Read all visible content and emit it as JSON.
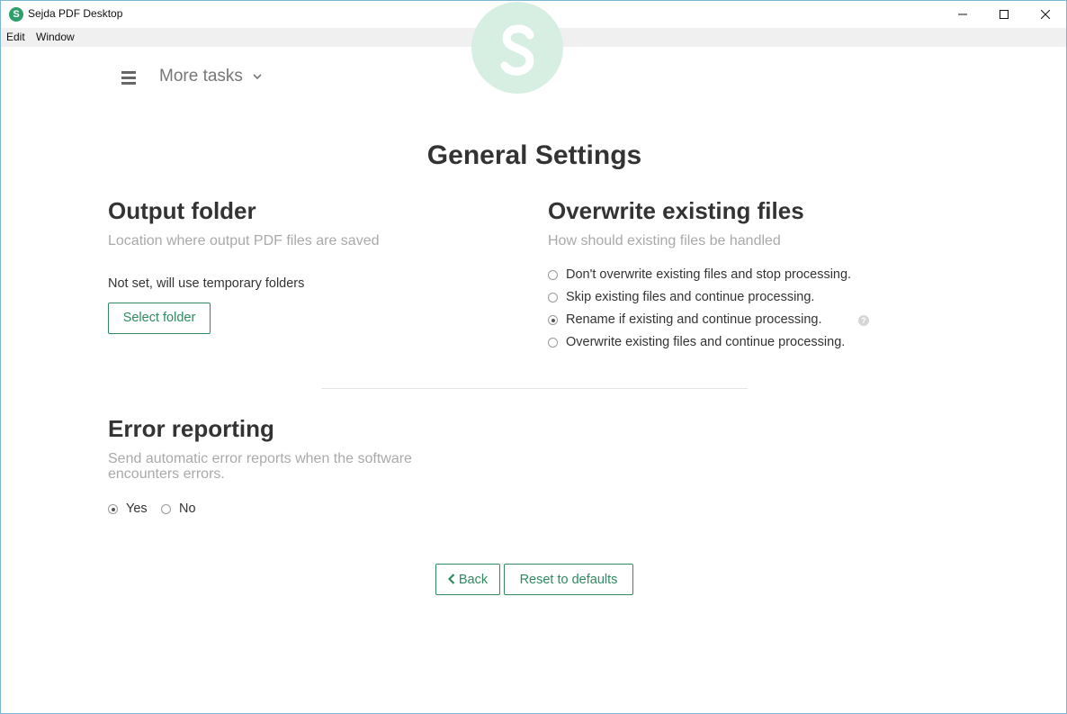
{
  "window": {
    "title": "Sejda PDF Desktop",
    "app_icon_letter": "S"
  },
  "menu": [
    "Edit",
    "Window"
  ],
  "header": {
    "more_tasks": "More tasks"
  },
  "page_title": "General Settings",
  "output_folder": {
    "title": "Output folder",
    "subtitle": "Location where output PDF files are saved",
    "status": "Not set, will use temporary folders",
    "button": "Select folder"
  },
  "overwrite": {
    "title": "Overwrite existing files",
    "subtitle": "How should existing files be handled",
    "options": [
      {
        "label": "Don't overwrite existing files and stop processing.",
        "checked": false
      },
      {
        "label": "Skip existing files and continue processing.",
        "checked": false
      },
      {
        "label": "Rename if existing and continue processing.",
        "checked": true
      },
      {
        "label": "Overwrite existing files and continue processing.",
        "checked": false
      }
    ],
    "help_glyph": "?"
  },
  "error_reporting": {
    "title": "Error reporting",
    "subtitle_line1": "Send automatic error reports when the software",
    "subtitle_line2": "encounters errors.",
    "yes": "Yes",
    "no": "No",
    "selected": "Yes"
  },
  "footer": {
    "back": "Back",
    "reset": "Reset to defaults"
  },
  "colors": {
    "accent": "#2e8b60",
    "logo_tint": "#d7efe3"
  }
}
